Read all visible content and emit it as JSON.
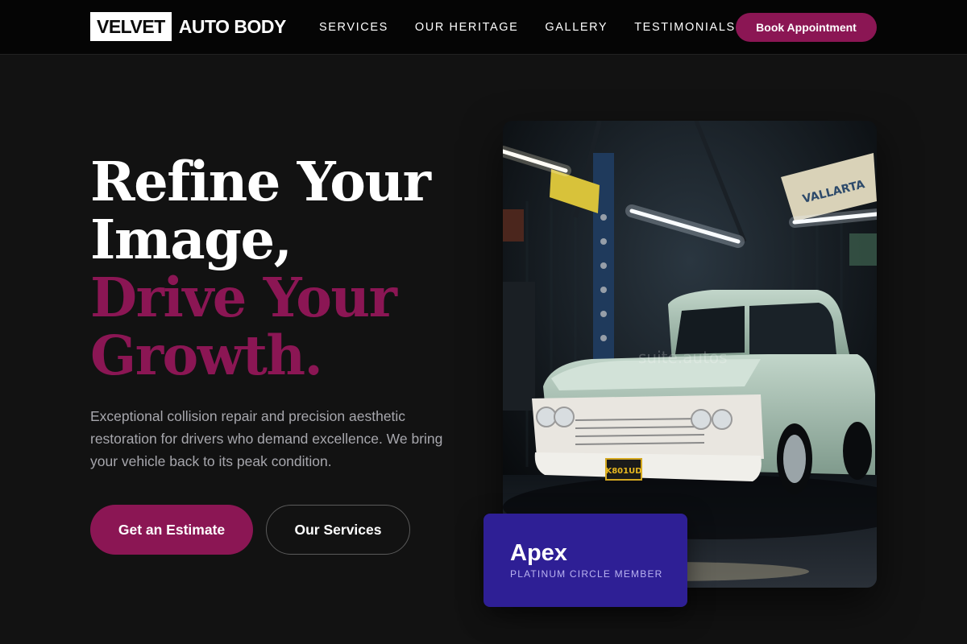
{
  "brand": {
    "logo_box": "VELVET",
    "logo_text": "AUTO BODY"
  },
  "nav": {
    "items": [
      "SERVICES",
      "OUR HERITAGE",
      "GALLERY",
      "TESTIMONIALS"
    ],
    "cta": "Book Appointment"
  },
  "hero": {
    "headline_line1": "Refine Your",
    "headline_line2": "Image,",
    "headline_line3": "Drive Your",
    "headline_line4": "Growth.",
    "subtext": "Exceptional collision repair and precision aesthetic restoration for drivers who demand excellence. We bring your vehicle back to its peak condition.",
    "primary_button": "Get an Estimate",
    "secondary_button": "Our Services"
  },
  "photo": {
    "watermark": "suite.autos",
    "plate": "K801UD",
    "sign_text": "VALLARTA"
  },
  "badge": {
    "title": "Apex",
    "subtitle": "PLATINUM CIRCLE MEMBER"
  },
  "colors": {
    "accent": "#8b1654",
    "badge": "#2e1f95",
    "background": "#121212",
    "header": "#050505"
  }
}
